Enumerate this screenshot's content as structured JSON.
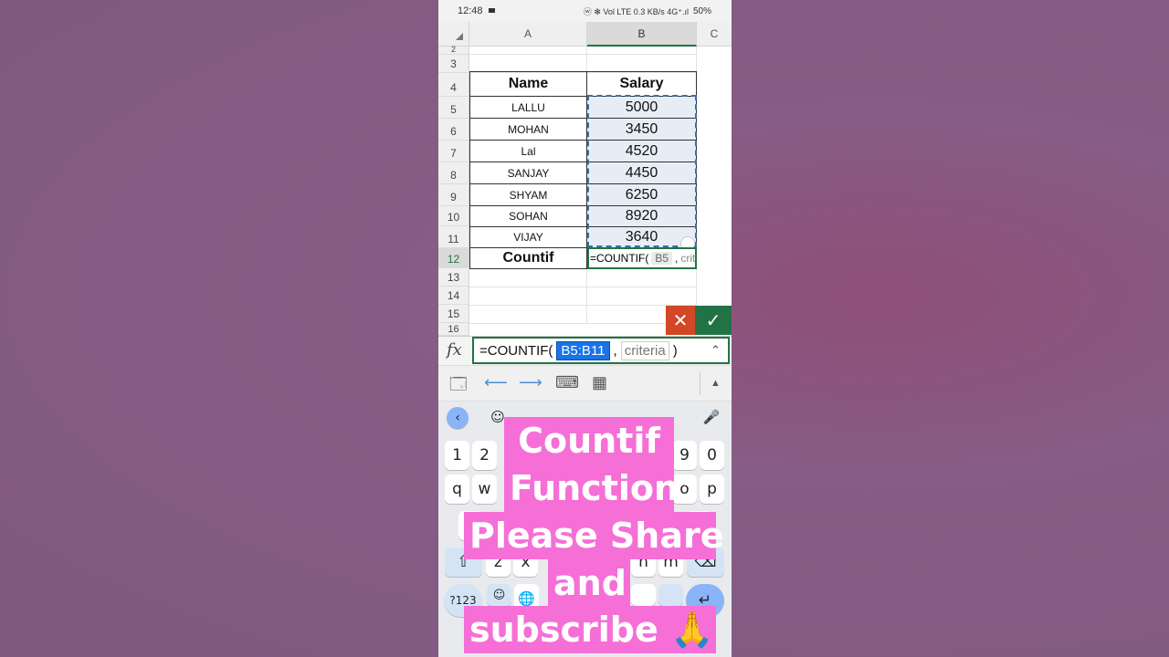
{
  "status_bar": {
    "time": "12:48",
    "indicators": "ⓦ ✻ Vol LTE 0.3 KB/s 4G⁺.ıl",
    "battery": "50%"
  },
  "spreadsheet": {
    "columns": [
      "A",
      "B",
      "C"
    ],
    "rows": [
      "2",
      "3",
      "4",
      "5",
      "6",
      "7",
      "8",
      "9",
      "10",
      "11",
      "12",
      "13",
      "14",
      "15",
      "16"
    ],
    "table": {
      "headers": [
        "Name",
        "Salary"
      ],
      "data": [
        [
          "LALLU",
          "5000"
        ],
        [
          "MOHAN",
          "3450"
        ],
        [
          "Lal",
          "4520"
        ],
        [
          "SANJAY",
          "4450"
        ],
        [
          "SHYAM",
          "6250"
        ],
        [
          "SOHAN",
          "8920"
        ],
        [
          "VIJAY",
          "3640"
        ]
      ],
      "footer_label": "Countif",
      "footer_formula_prefix": "=COUNTIF(",
      "footer_formula_arg1": "B5",
      "footer_formula_sep": ",",
      "footer_formula_arg2": "crite"
    }
  },
  "formula_bar": {
    "fx_label": "fx",
    "prefix": "=COUNTIF(",
    "range": "B5:B11",
    "separator": ",",
    "criteria": "criteria",
    "suffix": ")"
  },
  "keyboard": {
    "row_numbers": [
      "1",
      "2",
      "9",
      "0"
    ],
    "row_letters_1": [
      "q",
      "w",
      "o",
      "p"
    ],
    "row_letters_3": [
      "z",
      "x",
      "n",
      "m"
    ],
    "symbols_key": "?123"
  },
  "overlay_text": {
    "line1": "Countif",
    "line2": "Function",
    "line3": "Please Share",
    "line4": "and",
    "line5": "subscribe 🙏"
  },
  "colors": {
    "excel_green": "#217346",
    "cancel_red": "#d24726",
    "overlay_pink": "#f56fd6",
    "range_blue": "#1a73e8"
  }
}
